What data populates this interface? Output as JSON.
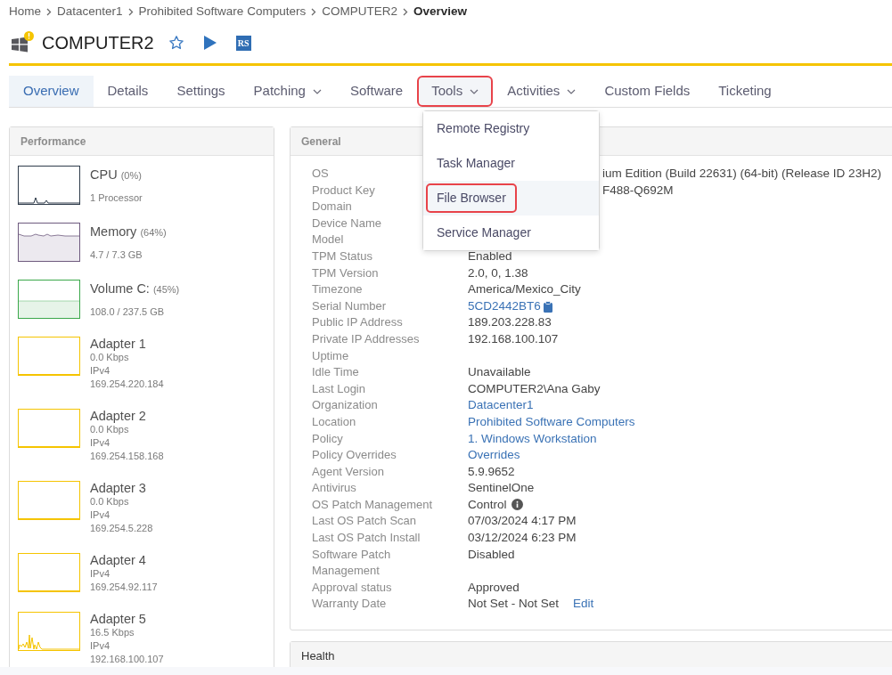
{
  "breadcrumb": [
    {
      "label": "Home",
      "current": false
    },
    {
      "label": "Datacenter1",
      "current": false
    },
    {
      "label": "Prohibited Software Computers",
      "current": false
    },
    {
      "label": "COMPUTER2",
      "current": false
    },
    {
      "label": "Overview",
      "current": true
    }
  ],
  "device": {
    "name": "COMPUTER2",
    "warning": true,
    "favorite": false,
    "logo_text": "RS"
  },
  "tabs": [
    {
      "label": "Overview",
      "selected": true,
      "dropdown": false,
      "expanded": false,
      "highlighted": false
    },
    {
      "label": "Details",
      "selected": false,
      "dropdown": false,
      "expanded": false,
      "highlighted": false
    },
    {
      "label": "Settings",
      "selected": false,
      "dropdown": false,
      "expanded": false,
      "highlighted": false
    },
    {
      "label": "Patching",
      "selected": false,
      "dropdown": true,
      "expanded": false,
      "highlighted": false
    },
    {
      "label": "Software",
      "selected": false,
      "dropdown": false,
      "expanded": false,
      "highlighted": false
    },
    {
      "label": "Tools",
      "selected": false,
      "dropdown": true,
      "expanded": true,
      "highlighted": true,
      "menu": {
        "items": [
          {
            "label": "Remote Registry",
            "hovered": false,
            "highlighted": false
          },
          {
            "label": "Task Manager",
            "hovered": false,
            "highlighted": false
          },
          {
            "label": "File Browser",
            "hovered": true,
            "highlighted": true
          },
          {
            "label": "Service Manager",
            "hovered": false,
            "highlighted": false
          }
        ]
      }
    },
    {
      "label": "Activities",
      "selected": false,
      "dropdown": true,
      "expanded": false,
      "highlighted": false
    },
    {
      "label": "Custom Fields",
      "selected": false,
      "dropdown": false,
      "expanded": false,
      "highlighted": false
    },
    {
      "label": "Ticketing",
      "selected": false,
      "dropdown": false,
      "expanded": false,
      "highlighted": false
    }
  ],
  "performance": {
    "title": "Performance",
    "items": [
      {
        "kind": "cpu",
        "color": "#2e3b4a",
        "name": "CPU",
        "percent": "(0%)",
        "detail": "1 Processor"
      },
      {
        "kind": "memory",
        "color": "#6e5a7e",
        "name": "Memory",
        "percent": "(64%)",
        "detail": "4.7 / 7.3 GB"
      },
      {
        "kind": "volume",
        "color": "#3aa84a",
        "name": "Volume C:",
        "percent": "(45%)",
        "detail": "108.0 / 237.5 GB"
      },
      {
        "kind": "adapter",
        "traffic": false,
        "color": "#f5c400",
        "name": "Adapter 1",
        "lines": [
          "0.0 Kbps",
          "IPv4",
          "169.254.220.184"
        ]
      },
      {
        "kind": "adapter",
        "traffic": false,
        "color": "#f5c400",
        "name": "Adapter 2",
        "lines": [
          "0.0 Kbps",
          "IPv4",
          "169.254.158.168"
        ]
      },
      {
        "kind": "adapter",
        "traffic": false,
        "color": "#f5c400",
        "name": "Adapter 3",
        "lines": [
          "0.0 Kbps",
          "IPv4",
          "169.254.5.228"
        ]
      },
      {
        "kind": "adapter",
        "traffic": false,
        "color": "#f5c400",
        "name": "Adapter 4",
        "lines": [
          "IPv4",
          "169.254.92.117"
        ]
      },
      {
        "kind": "adapter",
        "traffic": true,
        "color": "#f5c400",
        "name": "Adapter 5",
        "lines": [
          "16.5 Kbps",
          "IPv4",
          "192.168.100.107"
        ]
      }
    ]
  },
  "general": {
    "title": "General",
    "rows": [
      {
        "label": "OS",
        "kind": "text",
        "value": "ium Edition (Build 22631) (64-bit) (Release ID 23H2)",
        "covered": true
      },
      {
        "label": "Product Key",
        "kind": "text",
        "value": "F488-Q692M",
        "covered": true
      },
      {
        "label": "Domain"
      },
      {
        "label": "Device Name"
      },
      {
        "label": "Model"
      },
      {
        "label": "TPM Status",
        "kind": "text",
        "value": "Enabled"
      },
      {
        "label": "TPM Version",
        "kind": "text",
        "value": "2.0, 0, 1.38"
      },
      {
        "label": "Timezone",
        "kind": "text",
        "value": "America/Mexico_City"
      },
      {
        "label": "Serial Number",
        "kind": "link",
        "value": "5CD2442BT6",
        "copy": true
      },
      {
        "label": "Public IP Address",
        "kind": "text",
        "value": "189.203.228.83"
      },
      {
        "label": "Private IP Addresses",
        "kind": "text",
        "value": "192.168.100.107"
      },
      {
        "label": "Uptime"
      },
      {
        "label": "Idle Time",
        "kind": "text",
        "value": "Unavailable"
      },
      {
        "label": "Last Login",
        "kind": "text",
        "value": "COMPUTER2\\Ana Gaby"
      },
      {
        "label": "Organization",
        "kind": "link",
        "value": "Datacenter1"
      },
      {
        "label": "Location",
        "kind": "link",
        "value": "Prohibited Software Computers"
      },
      {
        "label": "Policy",
        "kind": "link",
        "value": "1. Windows Workstation"
      },
      {
        "label": "Policy Overrides",
        "kind": "link",
        "value": "Overrides"
      },
      {
        "label": "Agent Version",
        "kind": "text",
        "value": "5.9.9652"
      },
      {
        "label": "Antivirus",
        "kind": "text",
        "value": "SentinelOne"
      },
      {
        "label": "OS Patch Management",
        "kind": "text",
        "value": "Control",
        "info": true
      },
      {
        "label": "Last OS Patch Scan",
        "kind": "text",
        "value": "07/03/2024 4:17 PM"
      },
      {
        "label": "Last OS Patch Install",
        "kind": "text",
        "value": "03/12/2024 6:23 PM"
      },
      {
        "label": "Software Patch Management",
        "kind": "text",
        "value": "Disabled"
      },
      {
        "label": "Approval status",
        "kind": "text",
        "value": "Approved"
      },
      {
        "label": "Warranty Date",
        "kind": "text",
        "value": "Not Set - Not Set",
        "action": "Edit"
      }
    ]
  },
  "health": {
    "title": "Health"
  }
}
